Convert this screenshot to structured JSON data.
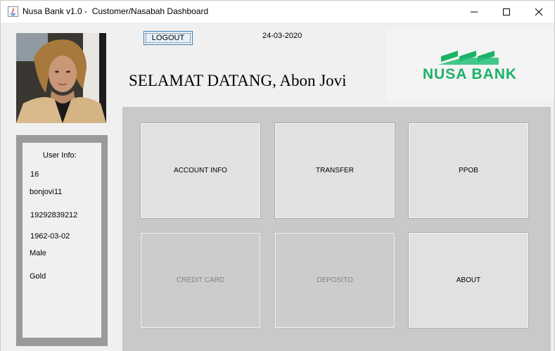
{
  "window": {
    "title": "Nusa Bank v1.0 -  Customer/Nasabah Dashboard"
  },
  "header": {
    "logout_label": "LOGOUT",
    "date": "24-03-2020",
    "welcome": "SELAMAT DATANG, Abon Jovi",
    "logo_text": "NUSA BANK"
  },
  "user_info": {
    "title": "User Info:",
    "id": "16",
    "username": "bonjovi11",
    "account_number": "19292839212",
    "birth_date": "1962-03-02",
    "gender": "Male",
    "membership": "Gold"
  },
  "menu": {
    "account_info": "ACCOUNT INFO",
    "transfer": "TRANSFER",
    "ppob": "PPOB",
    "credit_card": "CREDIT CARD",
    "deposito": "DEPOSITO",
    "about": "ABOUT"
  },
  "colors": {
    "logo_green": "#1bb268",
    "panel_gray": "#c9c9c9",
    "info_border_gray": "#9a9a9a"
  }
}
